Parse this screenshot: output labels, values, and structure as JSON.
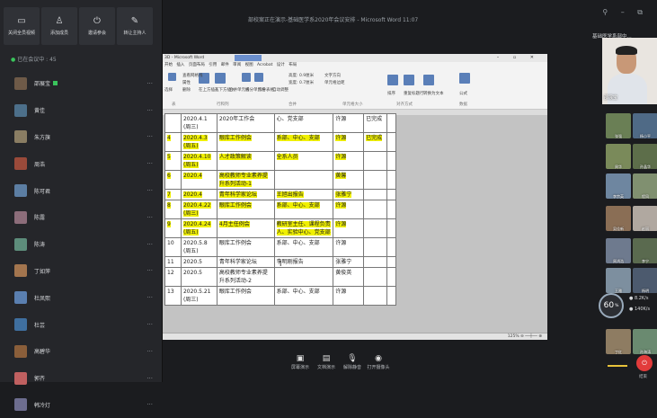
{
  "window_title": "部校案正在演示-基础医学系2020年会议安排 - Microsoft Word 11:07",
  "window_controls": "⚲ – ⧉",
  "top_buttons": [
    {
      "label": "关闭全员视频",
      "icon": "▭"
    },
    {
      "label": "添加成员",
      "icon": "♙"
    },
    {
      "label": "邀请参会",
      "icon": "⏻"
    },
    {
      "label": "转让主持人",
      "icon": "✎"
    }
  ],
  "participant_count": "已在会议中 : 45",
  "participants": [
    {
      "name": "邵展宝",
      "color": "#6e5a48",
      "speaking": true
    },
    {
      "name": "黄佳",
      "color": "#4c6f8a"
    },
    {
      "name": "朱方旗",
      "color": "#8a7d63"
    },
    {
      "name": "周浩",
      "color": "#9a4a3a"
    },
    {
      "name": "陈可君",
      "color": "#5c7ea3"
    },
    {
      "name": "陈露",
      "color": "#8c6d7a"
    },
    {
      "name": "陈涛",
      "color": "#5d8d7b"
    },
    {
      "name": "丁如萍",
      "color": "#a3754e"
    },
    {
      "name": "杜凤熙",
      "color": "#5a7fb0"
    },
    {
      "name": "杜芸",
      "color": "#3f6f9f"
    },
    {
      "name": "高碧华",
      "color": "#8a5e3a"
    },
    {
      "name": "郭齐",
      "color": "#c06060"
    },
    {
      "name": "韩冷灯",
      "color": "#6d6d8f"
    }
  ],
  "word": {
    "title": "3D - Microsoft Word",
    "context_tab": "表格工具",
    "tabs": "开始 插入 页面布局 引用 邮件 审阅 视图 Acrobat 设计 布局",
    "ribbon_groups": [
      "表",
      "行和列",
      "合并",
      "单元格大小",
      "对齐方式",
      "数据"
    ],
    "ribbon_labels": [
      "选择",
      "查看网格线",
      "属性",
      "删除",
      "在上方插入",
      "在下方插入",
      "合并单元格",
      "拆分单元格",
      "拆分表格",
      "自动调整",
      "高度: 0.9厘米",
      "宽度: 0.7厘米",
      "文字方向",
      "单元格边距",
      "排序",
      "重复标题行",
      "转换为文本",
      "公式"
    ],
    "status": "125% ⊖ ──┼── ⊕",
    "rows": [
      {
        "no": "",
        "date": "2020.4.1 (周三)",
        "content": "2020年工作会",
        "person": "心、党支部",
        "host": "许源",
        "status": "已完成",
        "hl": false
      },
      {
        "no": "4",
        "date": "2020.4.3 (周五)",
        "content": "眼库工作例会",
        "person": "系部、中心、支部",
        "host": "许源",
        "status": "已完成",
        "hl": true
      },
      {
        "no": "5",
        "date": "2020.4.10 (周五)",
        "content": "人才政策解读",
        "person": "全系人员",
        "host": "许源",
        "status": "",
        "hl": true
      },
      {
        "no": "6",
        "date": "2020.4",
        "content": "高校教师专业素养提升系列活动-1",
        "person": "",
        "host": "黄馨",
        "status": "",
        "hl": true
      },
      {
        "no": "7",
        "date": "2020.4",
        "content": "青年科学家论坛",
        "person": "王旭出报告",
        "host": "张雅宁",
        "status": "",
        "hl": true
      },
      {
        "no": "8",
        "date": "2020.4.22 (周三)",
        "content": "眼库工作例会",
        "person": "系部、中心、支部",
        "host": "许源",
        "status": "",
        "hl": true
      },
      {
        "no": "9",
        "date": "2020.4.24 (周五)",
        "content": "4月主任例会",
        "person": "教研室主任、课程负责人、实验中心、党支部",
        "host": "许源",
        "status": "",
        "hl": true
      },
      {
        "no": "10",
        "date": "2020.5.8 (周五)",
        "content": "眼库工作例会",
        "person": "系部、中心、支部",
        "host": "许源",
        "status": "",
        "hl": false
      },
      {
        "no": "11",
        "date": "2020.5",
        "content": "青年科学家论坛",
        "person": "李明刚报告",
        "host": "张雅宁",
        "status": "",
        "hl": false
      },
      {
        "no": "12",
        "date": "2020.5",
        "content": "高校教师专业素养提升系列活动-2",
        "person": "",
        "host": "黄俊英",
        "status": "",
        "hl": false
      },
      {
        "no": "13",
        "date": "2020.5.21 (周三)",
        "content": "眼库工作例会",
        "person": "系部、中心、支部",
        "host": "许源",
        "status": "",
        "hl": false
      }
    ]
  },
  "bottom_bar": [
    {
      "label": "屏幕演示",
      "icon": "▣"
    },
    {
      "label": "文档演示",
      "icon": "▤"
    },
    {
      "label": "解除静音",
      "icon": "🎙"
    },
    {
      "label": "打开摄像头",
      "icon": "◉"
    }
  ],
  "meeting_name": "基础医学系部中...",
  "speaker_label": "邵展宝",
  "thumbnails": [
    {
      "name": "张强",
      "color": "#6a7f55"
    },
    {
      "name": "杨小平",
      "color": "#4f6a86"
    },
    {
      "name": "周华",
      "color": "#7a8a5a"
    },
    {
      "name": "孙晶华",
      "color": "#5d6e4a"
    },
    {
      "name": "李宗英",
      "color": "#6e86a0"
    },
    {
      "name": "程凤",
      "color": "#809070"
    },
    {
      "name": "吴佳新",
      "color": "#8a6e55"
    },
    {
      "name": "赵丽",
      "color": "#b0a8a0"
    },
    {
      "name": "周鸿浩",
      "color": "#6e7a8e"
    },
    {
      "name": "李宁",
      "color": "#5a6a4f"
    },
    {
      "name": "王雅",
      "color": "#7d8f9f"
    },
    {
      "name": "杨明",
      "color": "#4c5a6e"
    },
    {
      "name": "丁红",
      "color": "#8e7c62"
    },
    {
      "name": "孙海涛",
      "color": "#6a8a70"
    }
  ],
  "network": {
    "percent": "60",
    "unit": "%",
    "up": "8.2K/s",
    "down": "140K/s"
  },
  "end_label": "结束",
  "end_icon": "⏻"
}
